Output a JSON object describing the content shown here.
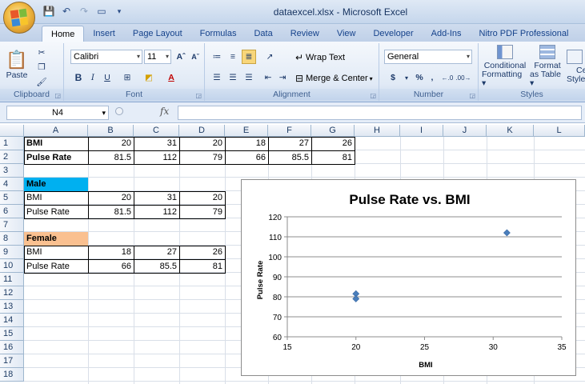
{
  "window": {
    "title": "dataexcel.xlsx - Microsoft Excel",
    "office_button": "Office"
  },
  "tabs": [
    "Home",
    "Insert",
    "Page Layout",
    "Formulas",
    "Data",
    "Review",
    "View",
    "Developer",
    "Add-Ins",
    "Nitro PDF Professional"
  ],
  "ribbon": {
    "clipboard": {
      "label": "Clipboard",
      "paste": "Paste"
    },
    "font": {
      "label": "Font",
      "name": "Calibri",
      "size": "11"
    },
    "alignment": {
      "label": "Alignment",
      "wrap_text": "Wrap Text",
      "merge_center": "Merge & Center"
    },
    "number": {
      "label": "Number",
      "format": "General",
      "currency": "$",
      "percent": "%",
      "comma": ","
    },
    "styles": {
      "label": "Styles",
      "conditional_1": "Conditional",
      "conditional_2": "Formatting",
      "format_1": "Format",
      "format_2": "as Table",
      "cell_1": "Ce",
      "cell_2": "Style"
    }
  },
  "formula_bar": {
    "name_box": "N4",
    "fx": "fx",
    "formula": ""
  },
  "columns": [
    "A",
    "B",
    "C",
    "D",
    "E",
    "F",
    "G",
    "H",
    "I",
    "J",
    "K",
    "L"
  ],
  "rows": [
    "1",
    "2",
    "3",
    "4",
    "5",
    "6",
    "7",
    "8",
    "9",
    "10",
    "11",
    "12",
    "13",
    "14",
    "15",
    "16",
    "17",
    "18"
  ],
  "cells": {
    "r1": {
      "a": "BMI",
      "b": "20",
      "c": "31",
      "d": "20",
      "e": "18",
      "f": "27",
      "g": "26"
    },
    "r2": {
      "a": "Pulse Rate",
      "b": "81.5",
      "c": "112",
      "d": "79",
      "e": "66",
      "f": "85.5",
      "g": "81"
    },
    "r4": {
      "a": "Male"
    },
    "r5": {
      "a": "BMI",
      "b": "20",
      "c": "31",
      "d": "20"
    },
    "r6": {
      "a": "Pulse Rate",
      "b": "81.5",
      "c": "112",
      "d": "79"
    },
    "r8": {
      "a": "Female"
    },
    "r9": {
      "a": "BMI",
      "b": "18",
      "c": "27",
      "d": "26"
    },
    "r10": {
      "a": "Pulse Rate",
      "b": "66",
      "c": "85.5",
      "d": "81"
    }
  },
  "colors": {
    "male_fill": "#00b0f0",
    "female_fill": "#fac090",
    "marker": "#4a7ebb"
  },
  "chart_data": {
    "type": "scatter",
    "title": "Pulse Rate vs. BMI",
    "xlabel": "BMI",
    "ylabel": "Pulse Rate",
    "xlim": [
      15,
      35
    ],
    "ylim": [
      60,
      120
    ],
    "xticks": [
      "15",
      "20",
      "25",
      "30",
      "35"
    ],
    "yticks": [
      "60",
      "70",
      "80",
      "90",
      "100",
      "110",
      "120"
    ],
    "grid": "horizontal",
    "legend": "none",
    "series": [
      {
        "x": [
          20,
          31,
          20
        ],
        "y": [
          81.5,
          112,
          79
        ]
      }
    ]
  }
}
